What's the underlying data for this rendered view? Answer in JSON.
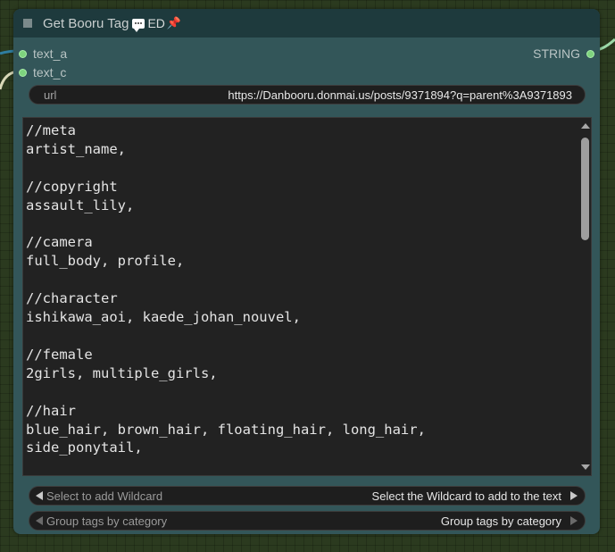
{
  "node": {
    "title": "Get Booru Tag",
    "badge_label": "ED",
    "chat_icon": "chat-bubble-icon",
    "pin_icon": "pushpin-icon"
  },
  "inputs": [
    {
      "label": "text_a"
    },
    {
      "label": "text_c"
    }
  ],
  "output": {
    "label": "STRING"
  },
  "url_widget": {
    "label": "url",
    "value": "https://Danbooru.donmai.us/posts/9371894?q=parent%3A9371893"
  },
  "textarea": {
    "content": "//meta\nartist_name,\n\n//copyright\nassault_lily,\n\n//camera\nfull_body, profile,\n\n//character\nishikawa_aoi, kaede_johan_nouvel,\n\n//female\n2girls, multiple_girls,\n\n//hair\nblue_hair, brown_hair, floating_hair, long_hair,\nside_ponytail,"
  },
  "wildcard_combo": {
    "label": "Select to add Wildcard",
    "value": "Select the Wildcard to add to the text"
  },
  "group_combo": {
    "label": "Group tags by category",
    "value": "Group tags by category"
  },
  "colors": {
    "node_body": "#335659",
    "node_title": "#1e3a3d",
    "slot_dot": "#7ed37e",
    "pin": "#e0302a"
  }
}
